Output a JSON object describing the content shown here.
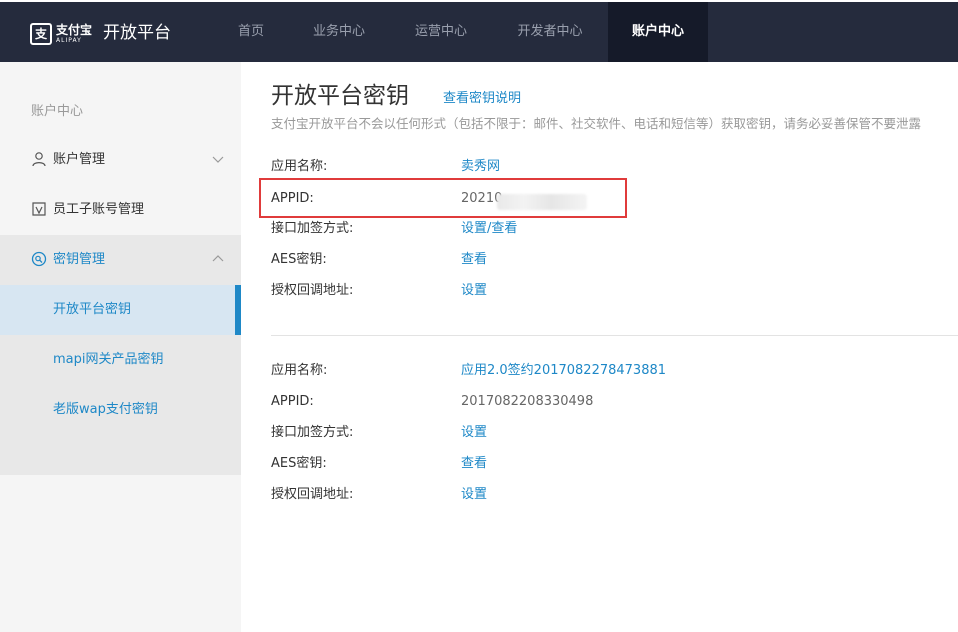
{
  "topbar": {
    "brand_cn": "支付宝",
    "brand_en": "ALIPAY",
    "brand_glyph": "支",
    "platform_title": "开放平台",
    "nav": [
      {
        "label": "首页"
      },
      {
        "label": "业务中心"
      },
      {
        "label": "运营中心"
      },
      {
        "label": "开发者中心"
      },
      {
        "label": "账户中心",
        "active": true
      }
    ]
  },
  "sidebar": {
    "header": "账户中心",
    "items": [
      {
        "label": "账户管理",
        "icon": "user-icon",
        "expanded": false
      },
      {
        "label": "员工子账号管理",
        "icon": "staff-icon"
      },
      {
        "label": "密钥管理",
        "icon": "key-icon",
        "expanded": true
      },
      {
        "label": "开放平台密钥",
        "active": true
      },
      {
        "label": "mapi网关产品密钥"
      },
      {
        "label": "老版wap支付密钥"
      }
    ]
  },
  "main": {
    "title": "开放平台密钥",
    "doc_link": "查看密钥说明",
    "notice": "支付宝开放平台不会以任何形式（包括不限于：邮件、社交软件、电话和短信等）获取密钥，请务必妥善保管不要泄露",
    "apps": [
      {
        "rows": [
          {
            "label": "应用名称:",
            "value": "卖秀网"
          },
          {
            "label": "APPID:",
            "value": "20210"
          },
          {
            "label": "接口加签方式:",
            "value": "设置/查看"
          },
          {
            "label": "AES密钥:",
            "value": "查看"
          },
          {
            "label": "授权回调地址:",
            "value": "设置"
          }
        ]
      },
      {
        "rows": [
          {
            "label": "应用名称:",
            "value": "应用2.0签约2017082278473881"
          },
          {
            "label": "APPID:",
            "value": "2017082208330498"
          },
          {
            "label": "接口加签方式:",
            "value": "设置"
          },
          {
            "label": "AES密钥:",
            "value": "查看"
          },
          {
            "label": "授权回调地址:",
            "value": "设置"
          }
        ]
      }
    ]
  },
  "colors": {
    "topbar_bg": "#252b3d",
    "nav_active_bg": "#151a29",
    "link": "#1e88c7",
    "highlight": "#e03b3b",
    "sidebar_bg": "#f5f5f5"
  }
}
